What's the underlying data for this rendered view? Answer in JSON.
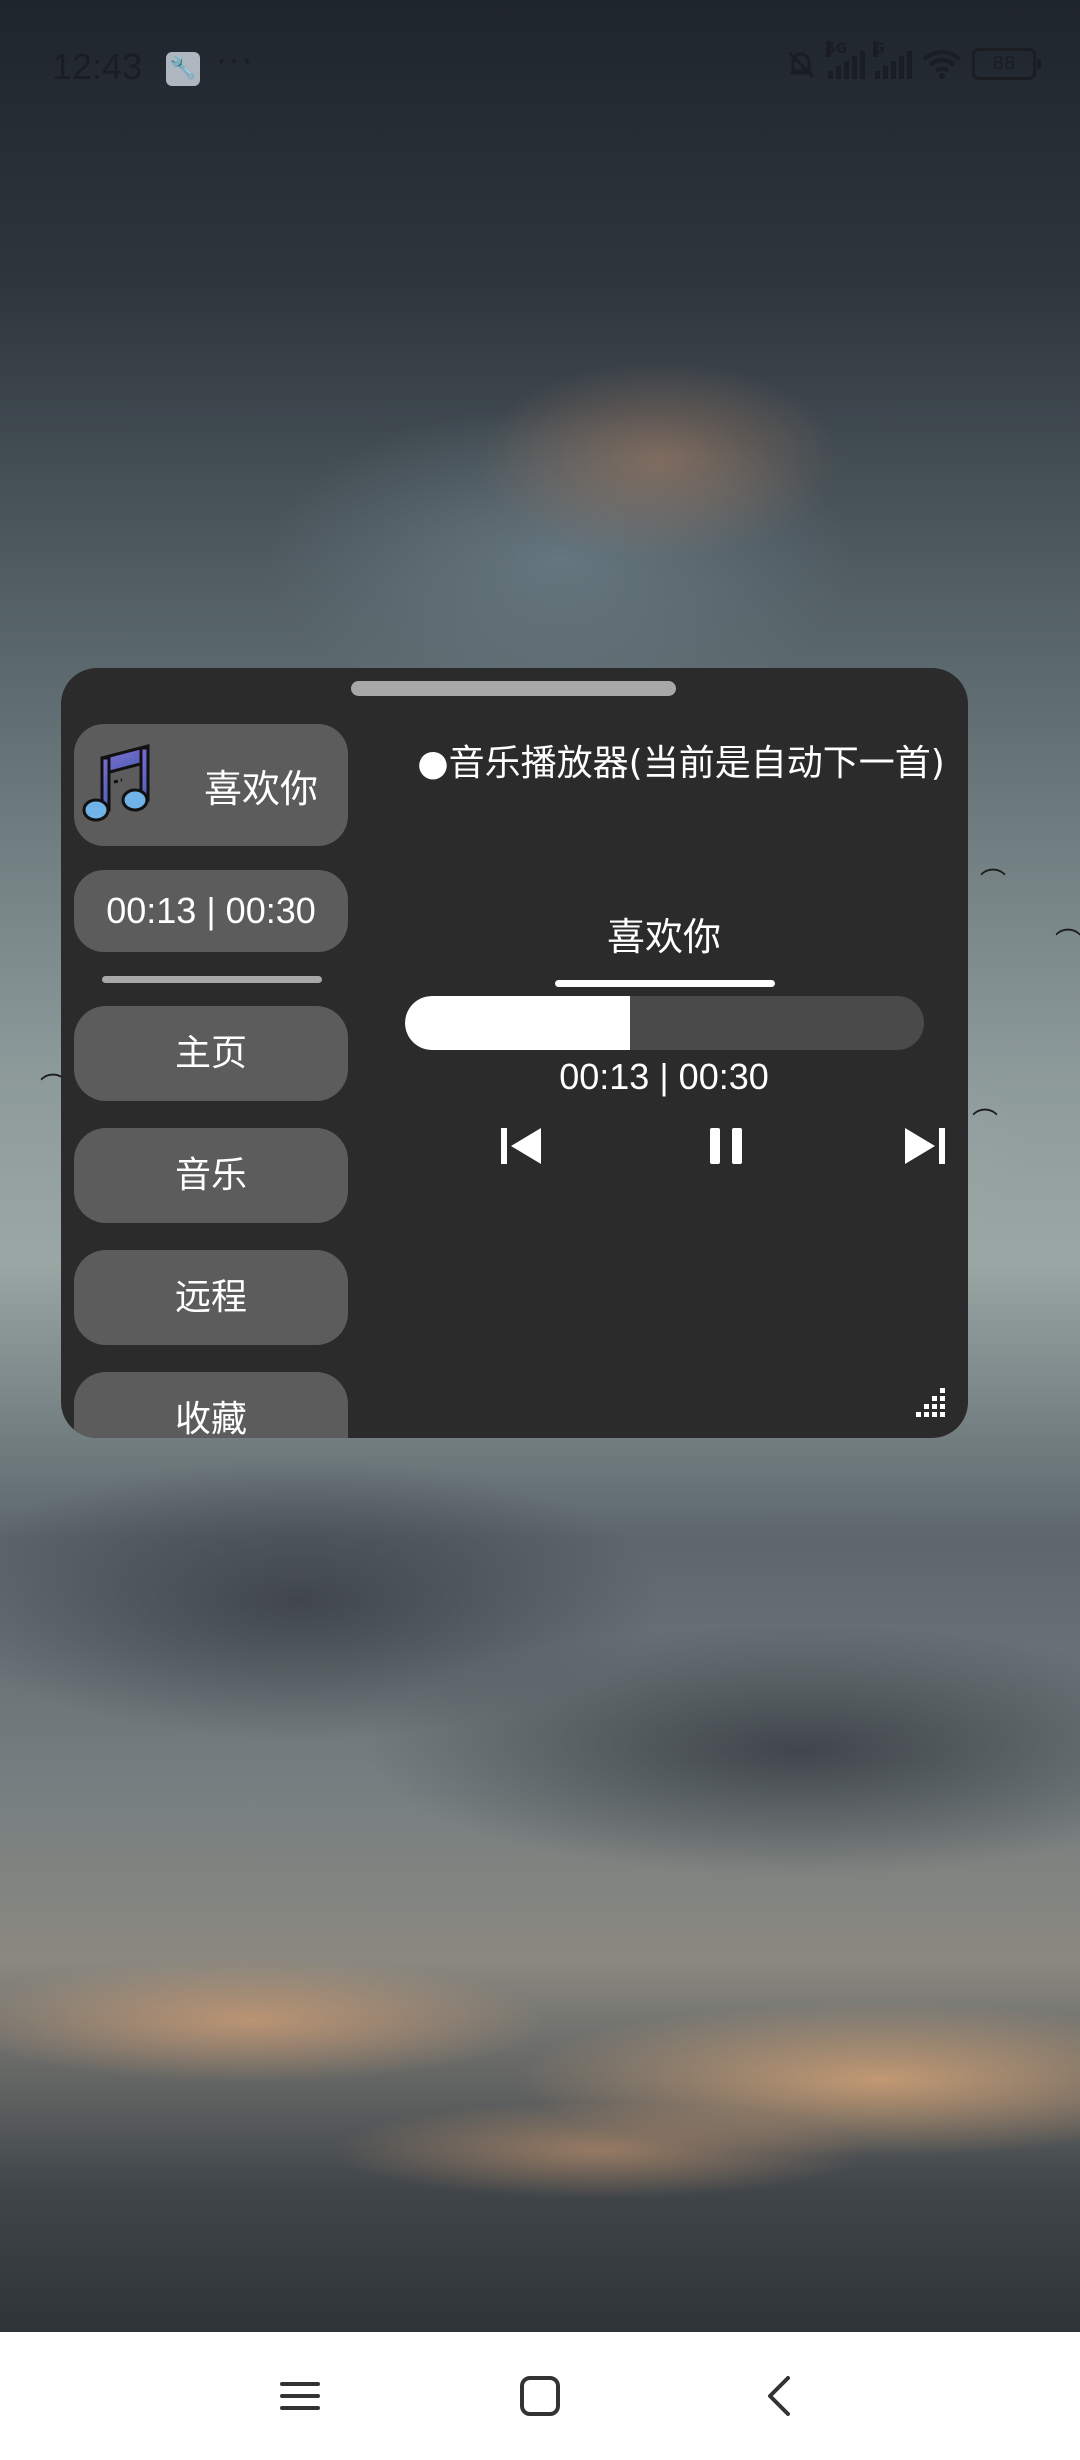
{
  "status_bar": {
    "time": "12:43",
    "sim1_label": "5G",
    "sim2_label": "G",
    "battery": "88"
  },
  "side_panel": {
    "now_playing_title": "喜欢你",
    "time_display": "00:13 | 00:30",
    "nav_items": [
      {
        "label": "主页"
      },
      {
        "label": "音乐"
      },
      {
        "label": "远程"
      },
      {
        "label": "收藏"
      }
    ]
  },
  "player": {
    "title": "●音乐播放器(当前是自动下一首)",
    "song_name": "喜欢你",
    "elapsed": "00:13",
    "duration": "00:30",
    "time_display": "00:13 | 00:30",
    "progress_fraction": 0.433,
    "controls": {
      "previous_icon": "skip-previous-icon",
      "pause_icon": "pause-icon",
      "next_icon": "skip-next-icon"
    }
  },
  "nav_bar": {
    "menu_icon": "menu-icon",
    "home_icon": "home-icon",
    "back_icon": "back-icon"
  },
  "colors": {
    "panel_bg": "#2b2b2b",
    "button_bg": "#5c5c5c",
    "track_bg": "#4a4a4a",
    "accent": "#ffffff"
  }
}
